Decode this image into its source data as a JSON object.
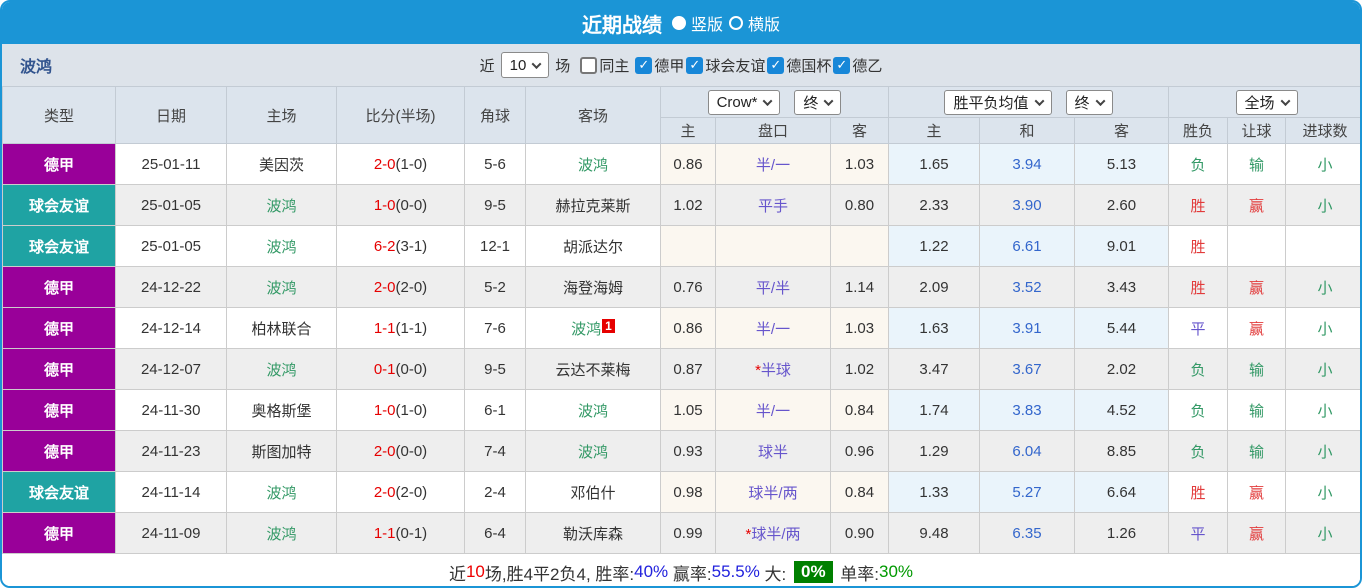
{
  "titlebar": {
    "title": "近期战绩",
    "radio_vertical": "竖版",
    "radio_horizontal": "横版"
  },
  "filterbar": {
    "team": "波鸿",
    "near_label": "近",
    "count_value": "10",
    "unit_label": "场",
    "same_home": {
      "label": "同主",
      "checked": false
    },
    "league_checkboxes": [
      {
        "label": "德甲",
        "checked": true
      },
      {
        "label": "球会友谊",
        "checked": true
      },
      {
        "label": "德国杯",
        "checked": true
      },
      {
        "label": "德乙",
        "checked": true
      }
    ]
  },
  "table": {
    "static_headers": [
      "类型",
      "日期",
      "主场",
      "比分(半场)",
      "角球",
      "客场"
    ],
    "group1": {
      "select1": "Crow*",
      "select2": "终",
      "subs": [
        "主",
        "盘口",
        "客"
      ]
    },
    "group2": {
      "select1": "胜平负均值",
      "select2": "终",
      "subs": [
        "主",
        "和",
        "客"
      ]
    },
    "group3": {
      "select1": "全场",
      "subs": [
        "胜负",
        "让球",
        "进球数"
      ]
    },
    "rows": [
      {
        "type": "德甲",
        "type_color": "#990099",
        "date": "25-01-11",
        "home": "美因茨",
        "home_green": false,
        "score_ft": "2-0",
        "score_ht": "(1-0)",
        "corner": "5-6",
        "away": "波鸿",
        "away_green": true,
        "away_badge": "",
        "odds_home": "0.86",
        "handicap": "半/一",
        "handicap_star": false,
        "odds_away": "1.03",
        "mean_home": "1.65",
        "mean_draw": "3.94",
        "mean_away": "5.13",
        "result": "负",
        "result_c": "green",
        "hres": "输",
        "hres_c": "green",
        "goals": "小",
        "goals_c": "green"
      },
      {
        "type": "球会友谊",
        "type_color": "#1fa3a3",
        "date": "25-01-05",
        "home": "波鸿",
        "home_green": true,
        "score_ft": "1-0",
        "score_ht": "(0-0)",
        "corner": "9-5",
        "away": "赫拉克莱斯",
        "away_green": false,
        "away_badge": "",
        "odds_home": "1.02",
        "handicap": "平手",
        "handicap_star": false,
        "odds_away": "0.80",
        "mean_home": "2.33",
        "mean_draw": "3.90",
        "mean_away": "2.60",
        "result": "胜",
        "result_c": "red",
        "hres": "赢",
        "hres_c": "red",
        "goals": "小",
        "goals_c": "green"
      },
      {
        "type": "球会友谊",
        "type_color": "#1fa3a3",
        "date": "25-01-05",
        "home": "波鸿",
        "home_green": true,
        "score_ft": "6-2",
        "score_ht": "(3-1)",
        "corner": "12-1",
        "away": "胡派达尔",
        "away_green": false,
        "away_badge": "",
        "odds_home": "",
        "handicap": "",
        "handicap_star": false,
        "odds_away": "",
        "mean_home": "1.22",
        "mean_draw": "6.61",
        "mean_away": "9.01",
        "result": "胜",
        "result_c": "red",
        "hres": "",
        "hres_c": "green",
        "goals": "",
        "goals_c": "green"
      },
      {
        "type": "德甲",
        "type_color": "#990099",
        "date": "24-12-22",
        "home": "波鸿",
        "home_green": true,
        "score_ft": "2-0",
        "score_ht": "(2-0)",
        "corner": "5-2",
        "away": "海登海姆",
        "away_green": false,
        "away_badge": "",
        "odds_home": "0.76",
        "handicap": "平/半",
        "handicap_star": false,
        "odds_away": "1.14",
        "mean_home": "2.09",
        "mean_draw": "3.52",
        "mean_away": "3.43",
        "result": "胜",
        "result_c": "red",
        "hres": "赢",
        "hres_c": "red",
        "goals": "小",
        "goals_c": "green"
      },
      {
        "type": "德甲",
        "type_color": "#990099",
        "date": "24-12-14",
        "home": "柏林联合",
        "home_green": false,
        "score_ft": "1-1",
        "score_ht": "(1-1)",
        "corner": "7-6",
        "away": "波鸿",
        "away_green": true,
        "away_badge": "1",
        "odds_home": "0.86",
        "handicap": "半/一",
        "handicap_star": false,
        "odds_away": "1.03",
        "mean_home": "1.63",
        "mean_draw": "3.91",
        "mean_away": "5.44",
        "result": "平",
        "result_c": "blue",
        "hres": "赢",
        "hres_c": "red",
        "goals": "小",
        "goals_c": "green"
      },
      {
        "type": "德甲",
        "type_color": "#990099",
        "date": "24-12-07",
        "home": "波鸿",
        "home_green": true,
        "score_ft": "0-1",
        "score_ht": "(0-0)",
        "corner": "9-5",
        "away": "云达不莱梅",
        "away_green": false,
        "away_badge": "",
        "odds_home": "0.87",
        "handicap": "半球",
        "handicap_star": true,
        "odds_away": "1.02",
        "mean_home": "3.47",
        "mean_draw": "3.67",
        "mean_away": "2.02",
        "result": "负",
        "result_c": "green",
        "hres": "输",
        "hres_c": "green",
        "goals": "小",
        "goals_c": "green"
      },
      {
        "type": "德甲",
        "type_color": "#990099",
        "date": "24-11-30",
        "home": "奥格斯堡",
        "home_green": false,
        "score_ft": "1-0",
        "score_ht": "(1-0)",
        "corner": "6-1",
        "away": "波鸿",
        "away_green": true,
        "away_badge": "",
        "odds_home": "1.05",
        "handicap": "半/一",
        "handicap_star": false,
        "odds_away": "0.84",
        "mean_home": "1.74",
        "mean_draw": "3.83",
        "mean_away": "4.52",
        "result": "负",
        "result_c": "green",
        "hres": "输",
        "hres_c": "green",
        "goals": "小",
        "goals_c": "green"
      },
      {
        "type": "德甲",
        "type_color": "#990099",
        "date": "24-11-23",
        "home": "斯图加特",
        "home_green": false,
        "score_ft": "2-0",
        "score_ht": "(0-0)",
        "corner": "7-4",
        "away": "波鸿",
        "away_green": true,
        "away_badge": "",
        "odds_home": "0.93",
        "handicap": "球半",
        "handicap_star": false,
        "odds_away": "0.96",
        "mean_home": "1.29",
        "mean_draw": "6.04",
        "mean_away": "8.85",
        "result": "负",
        "result_c": "green",
        "hres": "输",
        "hres_c": "green",
        "goals": "小",
        "goals_c": "green"
      },
      {
        "type": "球会友谊",
        "type_color": "#1fa3a3",
        "date": "24-11-14",
        "home": "波鸿",
        "home_green": true,
        "score_ft": "2-0",
        "score_ht": "(2-0)",
        "corner": "2-4",
        "away": "邓伯什",
        "away_green": false,
        "away_badge": "",
        "odds_home": "0.98",
        "handicap": "球半/两",
        "handicap_star": false,
        "odds_away": "0.84",
        "mean_home": "1.33",
        "mean_draw": "5.27",
        "mean_away": "6.64",
        "result": "胜",
        "result_c": "red",
        "hres": "赢",
        "hres_c": "red",
        "goals": "小",
        "goals_c": "green"
      },
      {
        "type": "德甲",
        "type_color": "#990099",
        "date": "24-11-09",
        "home": "波鸿",
        "home_green": true,
        "score_ft": "1-1",
        "score_ht": "(0-1)",
        "corner": "6-4",
        "away": "勒沃库森",
        "away_green": false,
        "away_badge": "",
        "odds_home": "0.99",
        "handicap": "球半/两",
        "handicap_star": true,
        "odds_away": "0.90",
        "mean_home": "9.48",
        "mean_draw": "6.35",
        "mean_away": "1.26",
        "result": "平",
        "result_c": "blue",
        "hres": "赢",
        "hres_c": "red",
        "goals": "小",
        "goals_c": "green"
      }
    ]
  },
  "footer": {
    "segments": [
      {
        "text": "近",
        "color": "#333333"
      },
      {
        "text": "10",
        "color": "#ee0000"
      },
      {
        "text": "场,胜4平2负4, 胜率:",
        "color": "#333333"
      },
      {
        "text": "40%",
        "color": "#2222dd"
      },
      {
        "text": " 赢率:",
        "color": "#333333"
      },
      {
        "text": "55.5%",
        "color": "#2222dd"
      },
      {
        "text": " 大: ",
        "color": "#333333"
      },
      {
        "text": "0%",
        "color": "#ffffff",
        "bg": "#008000"
      },
      {
        "text": " 单率:",
        "color": "#333333"
      },
      {
        "text": "30%",
        "color": "#009900"
      }
    ]
  },
  "colors": {
    "accent_blue": "#1b95d6",
    "league_purple": "#990099",
    "league_teal": "#1fa3a3",
    "team_green": "#339966",
    "score_red": "#e60000",
    "handicap_purple": "#6655cc",
    "mean_blue": "#3366cc"
  }
}
